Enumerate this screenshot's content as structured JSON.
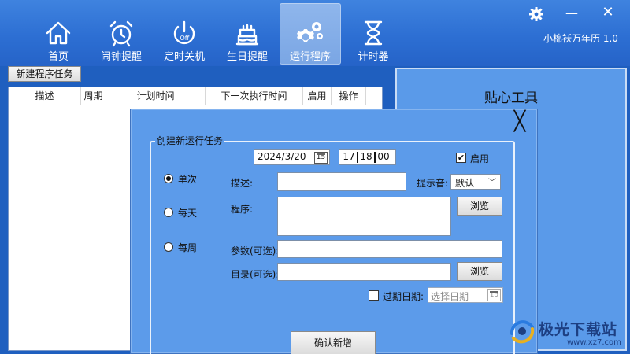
{
  "nav": {
    "items": [
      {
        "label": "首页",
        "icon": "home-icon"
      },
      {
        "label": "闹钟提醒",
        "icon": "alarm-clock-icon"
      },
      {
        "label": "定时关机",
        "icon": "power-off-icon"
      },
      {
        "label": "生日提醒",
        "icon": "birthday-cake-icon"
      },
      {
        "label": "运行程序",
        "icon": "gears-icon",
        "active": true
      },
      {
        "label": "计时器",
        "icon": "hourglass-icon"
      }
    ]
  },
  "window": {
    "title": "小棉袄万年历 1.0",
    "minimize_glyph": "—",
    "close_glyph": "✕"
  },
  "toolbar": {
    "new_task_label": "新建程序任务"
  },
  "table": {
    "columns": [
      "描述",
      "周期",
      "计划时间",
      "下一次执行时间",
      "启用",
      "操作"
    ],
    "rows": []
  },
  "right_panel": {
    "title": "贴心工具"
  },
  "dialog": {
    "close_glyph": "╳",
    "group_title": "创建新运行任务",
    "date": {
      "value": "2024/3/20",
      "cal_day": "15"
    },
    "time": {
      "hour": "17",
      "minute": "18",
      "second": "00"
    },
    "enable": {
      "label": "启用",
      "checked": true
    },
    "frequency": [
      {
        "label": "单次",
        "selected": true
      },
      {
        "label": "每天",
        "selected": false
      },
      {
        "label": "每周",
        "selected": false
      }
    ],
    "description_label": "描述:",
    "description_value": "",
    "sound_label": "提示音:",
    "sound_value": "默认",
    "program_label": "程序:",
    "program_value": "",
    "browse_label": "浏览",
    "args_label": "参数(可选):",
    "args_value": "",
    "dir_label": "目录(可选):",
    "dir_value": "",
    "browse2_label": "浏览",
    "expiry": {
      "label": "过期日期:",
      "checked": false,
      "placeholder": "选择日期",
      "cal_day": "15"
    },
    "confirm_label": "确认新增"
  },
  "watermark": {
    "text": "极光下载站",
    "url": "www.xz7.com"
  },
  "colors": {
    "accent": "#2d6fd3",
    "panel": "#5c9bea"
  }
}
